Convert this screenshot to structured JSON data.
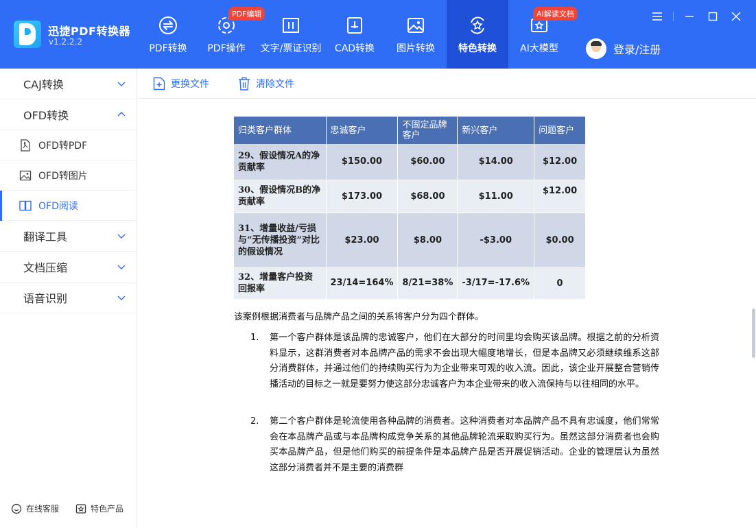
{
  "app": {
    "name": "迅捷PDF转换器",
    "version": "v1.2.2.2"
  },
  "nav": [
    {
      "label": "PDF转换",
      "icon": "pdf-convert-icon"
    },
    {
      "label": "PDF操作",
      "icon": "pdf-operation-icon",
      "badge": "PDF编辑"
    },
    {
      "label": "文字/票证识别",
      "icon": "ocr-icon"
    },
    {
      "label": "CAD转换",
      "icon": "cad-icon"
    },
    {
      "label": "图片转换",
      "icon": "image-icon"
    },
    {
      "label": "特色转换",
      "icon": "special-convert-icon",
      "active": true
    },
    {
      "label": "AI大模型",
      "icon": "ai-model-icon",
      "badge": "AI解读文档"
    }
  ],
  "login": {
    "label": "登录/注册"
  },
  "sidebar": {
    "groups": [
      {
        "label": "CAJ转换"
      },
      {
        "label": "OFD转换",
        "expanded": true
      },
      {
        "label": "翻译工具"
      },
      {
        "label": "文档压缩"
      },
      {
        "label": "语音识别"
      }
    ],
    "ofd_items": [
      {
        "label": "OFD转PDF",
        "icon": "pdf-file-icon"
      },
      {
        "label": "OFD转图片",
        "icon": "image-file-icon"
      },
      {
        "label": "OFD阅读",
        "icon": "book-icon",
        "active": true
      }
    ],
    "footer": {
      "service": "在线客服",
      "products": "特色产品"
    }
  },
  "toolbar": {
    "replace": "更换文件",
    "clear": "清除文件"
  },
  "document": {
    "table": {
      "headers": [
        "归类客户群体",
        "忠诚客户",
        "不固定品牌客户",
        "新兴客户",
        "问题客户"
      ],
      "rows": [
        [
          "29、假设情况A的净贡献率",
          "$150.00",
          "$60.00",
          "$14.00",
          "$12.00"
        ],
        [
          "30、假设情况B的净贡献率",
          "$173.00",
          "$68.00",
          "$11.00",
          "$12.00"
        ],
        [
          "31、增量收益/亏损与“无传播投资”对比的假设情况",
          "$23.00",
          "$8.00",
          "-$3.00",
          "$0.00"
        ],
        [
          "32、增量客户投资回报率",
          "23/14=164%",
          "8/21=38%",
          "-3/17=-17.6%",
          "0"
        ]
      ]
    },
    "intro": "该案例根据消费者与品牌产品之间的关系将客户分为四个群体。",
    "list": [
      {
        "n": "1.",
        "text": "第一个客户群体是该品牌的忠诚客户，他们在大部分的时间里均会购买该品牌。根据之前的分析资料显示，这群消费者对本品牌产品的需求不会出现大幅度地增长，但是本品牌又必须继续维系这部分消费群体，并通过他们的持续购买行为为企业带来可观的收入流。因此，该企业开展整合营销传播活动的目标之一就是要努力使这部分忠诚客户为本企业带来的收入流保持与以往相同的水平。"
      },
      {
        "n": "2.",
        "text": "第二个客户群体是轮流使用各种品牌的消费者。这种消费者对本品牌产品不具有忠诚度，他们常常会在本品牌产品或与本品牌构成竞争关系的其他品牌轮流采取购买行为。虽然这部分消费者也会购买本品牌产品，但是他们购买的前提条件是本品牌产品是否开展促销活动。企业的管理层认为虽然这部分消费者并不是主要的消费群"
      }
    ]
  }
}
